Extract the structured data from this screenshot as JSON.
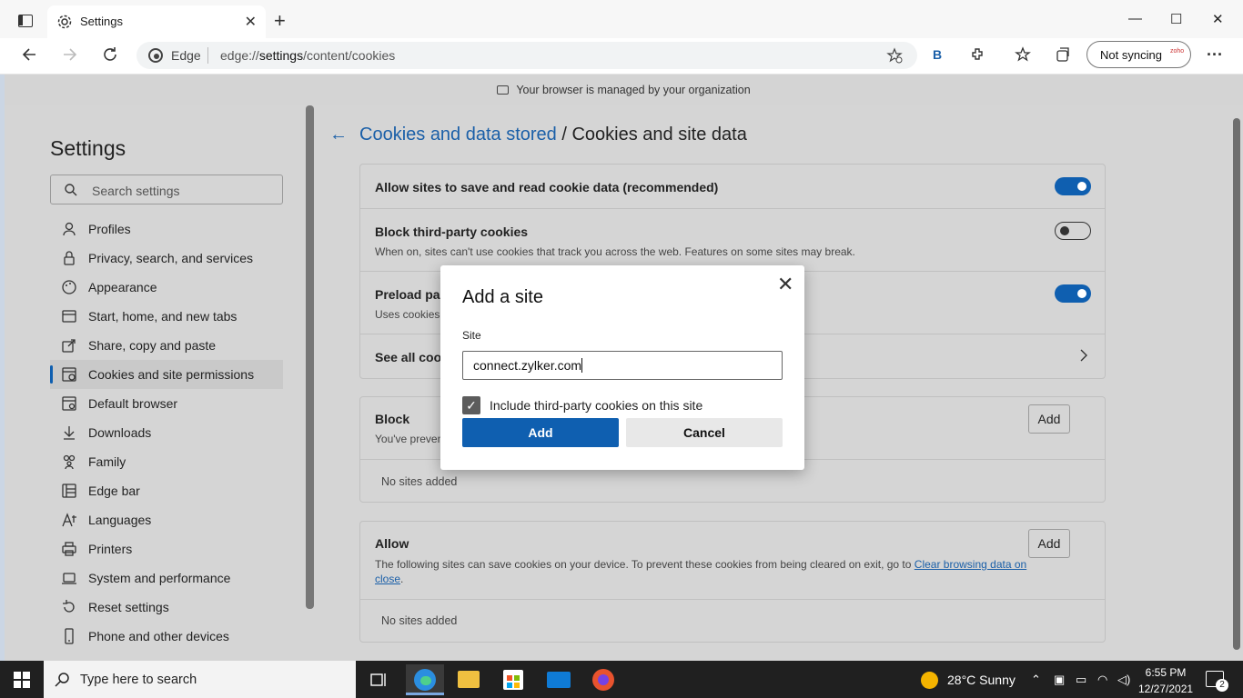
{
  "browser": {
    "tab_title": "Settings",
    "address_brand": "Edge",
    "url_prefix": "edge://",
    "url_host": "settings",
    "url_path": "/content/cookies",
    "sync_label": "Not syncing",
    "bing_label": "B",
    "new_tab": "+",
    "minimize": "—",
    "maximize": "☐",
    "close": "✕",
    "more": "···"
  },
  "banner": {
    "text": "Your browser is managed by your organization"
  },
  "sidebar": {
    "title": "Settings",
    "search_placeholder": "Search settings",
    "items": [
      {
        "label": "Profiles",
        "icon": "profile-icon"
      },
      {
        "label": "Privacy, search, and services",
        "icon": "lock-icon"
      },
      {
        "label": "Appearance",
        "icon": "appearance-icon"
      },
      {
        "label": "Start, home, and new tabs",
        "icon": "home-icon"
      },
      {
        "label": "Share, copy and paste",
        "icon": "share-icon"
      },
      {
        "label": "Cookies and site permissions",
        "icon": "cookies-icon",
        "active": true
      },
      {
        "label": "Default browser",
        "icon": "browser-icon"
      },
      {
        "label": "Downloads",
        "icon": "download-icon"
      },
      {
        "label": "Family",
        "icon": "family-icon"
      },
      {
        "label": "Edge bar",
        "icon": "edge-bar-icon"
      },
      {
        "label": "Languages",
        "icon": "languages-icon"
      },
      {
        "label": "Printers",
        "icon": "printer-icon"
      },
      {
        "label": "System and performance",
        "icon": "system-icon"
      },
      {
        "label": "Reset settings",
        "icon": "reset-icon"
      },
      {
        "label": "Phone and other devices",
        "icon": "phone-icon"
      }
    ]
  },
  "header": {
    "crumb_link": "Cookies and data stored",
    "crumb_sep": " / ",
    "crumb_current": "Cookies and site data"
  },
  "cookies": {
    "allow_label": "Allow sites to save and read cookie data (recommended)",
    "allow_on": true,
    "block_third_label": "Block third-party cookies",
    "block_third_desc": "When on, sites can't use cookies that track you across the web. Features on some sites may break.",
    "block_third_on": false,
    "preload_label": "Preload pag",
    "preload_desc": "Uses cookies t",
    "preload_on": true,
    "see_all_label": "See all cook"
  },
  "block_section": {
    "title": "Block",
    "desc": "You've preven",
    "add_label": "Add",
    "empty": "No sites added"
  },
  "allow_section": {
    "title": "Allow",
    "desc_part1": "The following sites can save cookies on your device. To prevent these cookies from being cleared on exit, go to ",
    "desc_link1": "Clear browsing data on",
    "desc_link2": "close",
    "desc_end": ".",
    "add_label": "Add",
    "empty": "No sites added"
  },
  "dialog": {
    "title": "Add a site",
    "site_label": "Site",
    "site_value": "connect.zylker.com",
    "checkbox_label": "Include third-party cookies on this site",
    "checkbox_checked": true,
    "add_button": "Add",
    "cancel_button": "Cancel"
  },
  "taskbar": {
    "search_placeholder": "Type here to search",
    "weather": "28°C  Sunny",
    "time": "6:55 PM",
    "date": "12/27/2021",
    "notifications": "2"
  }
}
